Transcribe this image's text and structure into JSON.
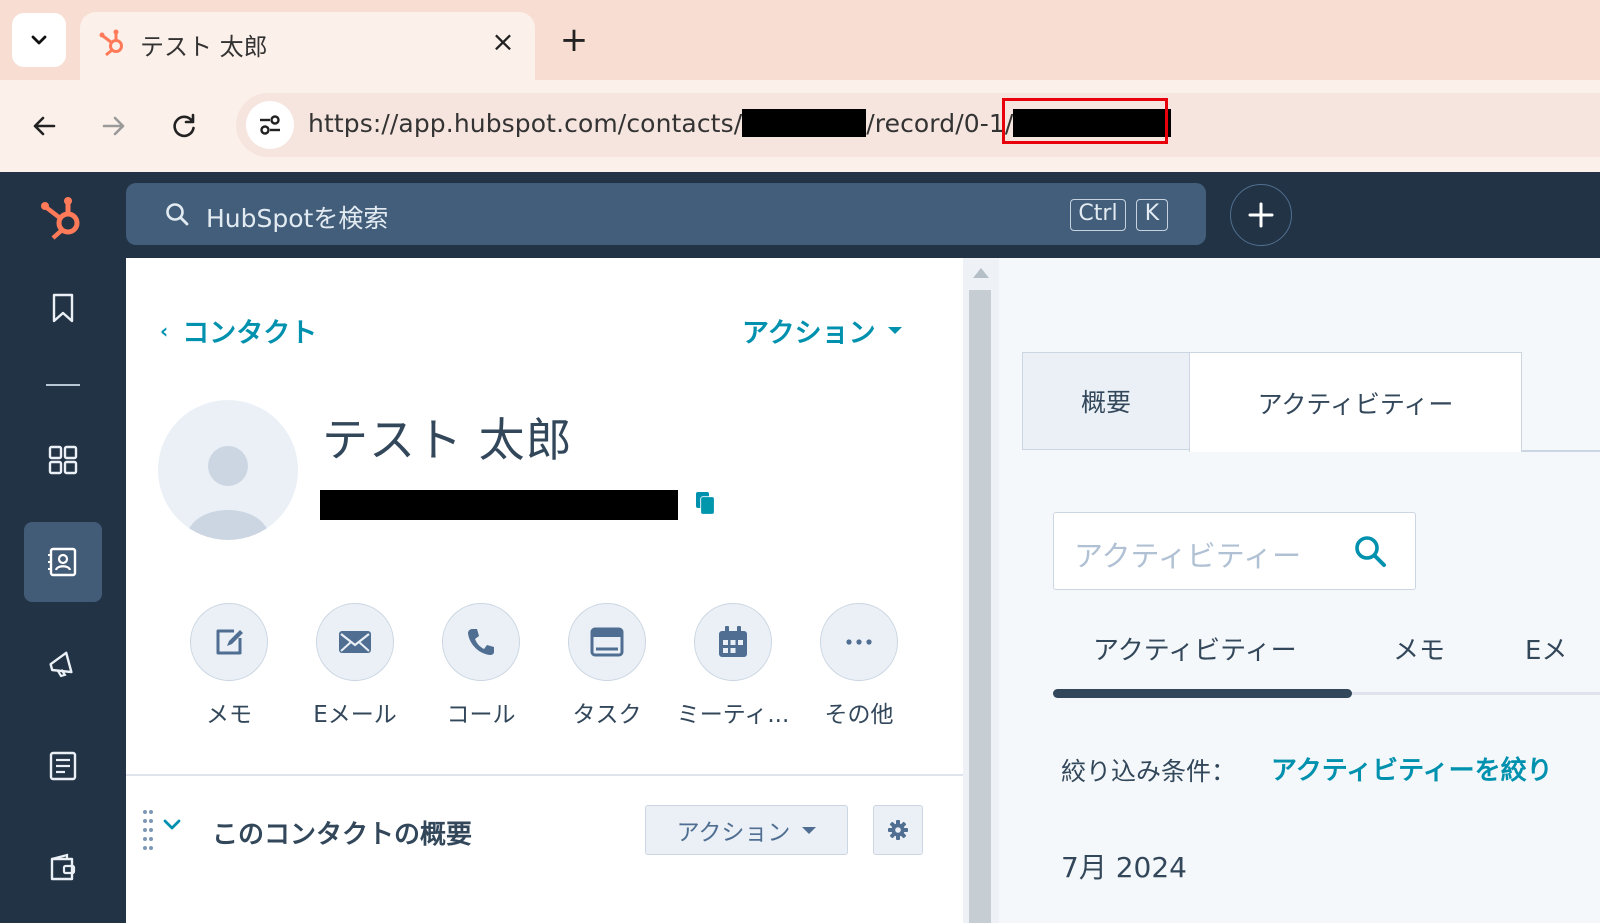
{
  "browser": {
    "tab_title": "テスト 太郎",
    "new_tab_symbol": "+",
    "close_symbol": "×",
    "url_part1": "https://app.hubspot.com/contacts/",
    "url_part2": "/record/0-1/"
  },
  "hubspot": {
    "search_placeholder": "HubSpotを検索",
    "shortcut_keys": [
      "Ctrl",
      "K"
    ],
    "create_symbol": "+"
  },
  "sidebar": {
    "items": [
      {
        "icon": "bookmark-icon"
      },
      {
        "icon": "grid-icon"
      },
      {
        "icon": "contacts-icon",
        "active": true
      },
      {
        "icon": "megaphone-icon"
      },
      {
        "icon": "content-icon"
      },
      {
        "icon": "wallet-icon"
      }
    ]
  },
  "record": {
    "back_label": "コンタクト",
    "actions_label": "アクション",
    "name": "テスト 太郎",
    "quick_actions": [
      {
        "label": "メモ",
        "icon": "edit-icon"
      },
      {
        "label": "Eメール",
        "icon": "email-icon"
      },
      {
        "label": "コール",
        "icon": "phone-icon"
      },
      {
        "label": "タスク",
        "icon": "task-icon"
      },
      {
        "label": "ミーティ...",
        "icon": "calendar-icon"
      },
      {
        "label": "その他",
        "icon": "more-icon"
      }
    ],
    "section_title": "このコンタクトの概要",
    "section_actions_label": "アクション"
  },
  "activity": {
    "tabs": [
      "概要",
      "アクティビティー"
    ],
    "search_placeholder": "アクティビティー",
    "subtabs": [
      "アクティビティー",
      "メモ",
      "Eメ"
    ],
    "filter_label": "絞り込み条件：",
    "filter_link": "アクティビティーを絞り",
    "month": "7月 2024"
  },
  "colors": {
    "hubspot_nav": "#223345",
    "accent_link": "#0091ae",
    "hubspot_orange": "#ff7a59",
    "highlight_box": "#e8000b"
  }
}
